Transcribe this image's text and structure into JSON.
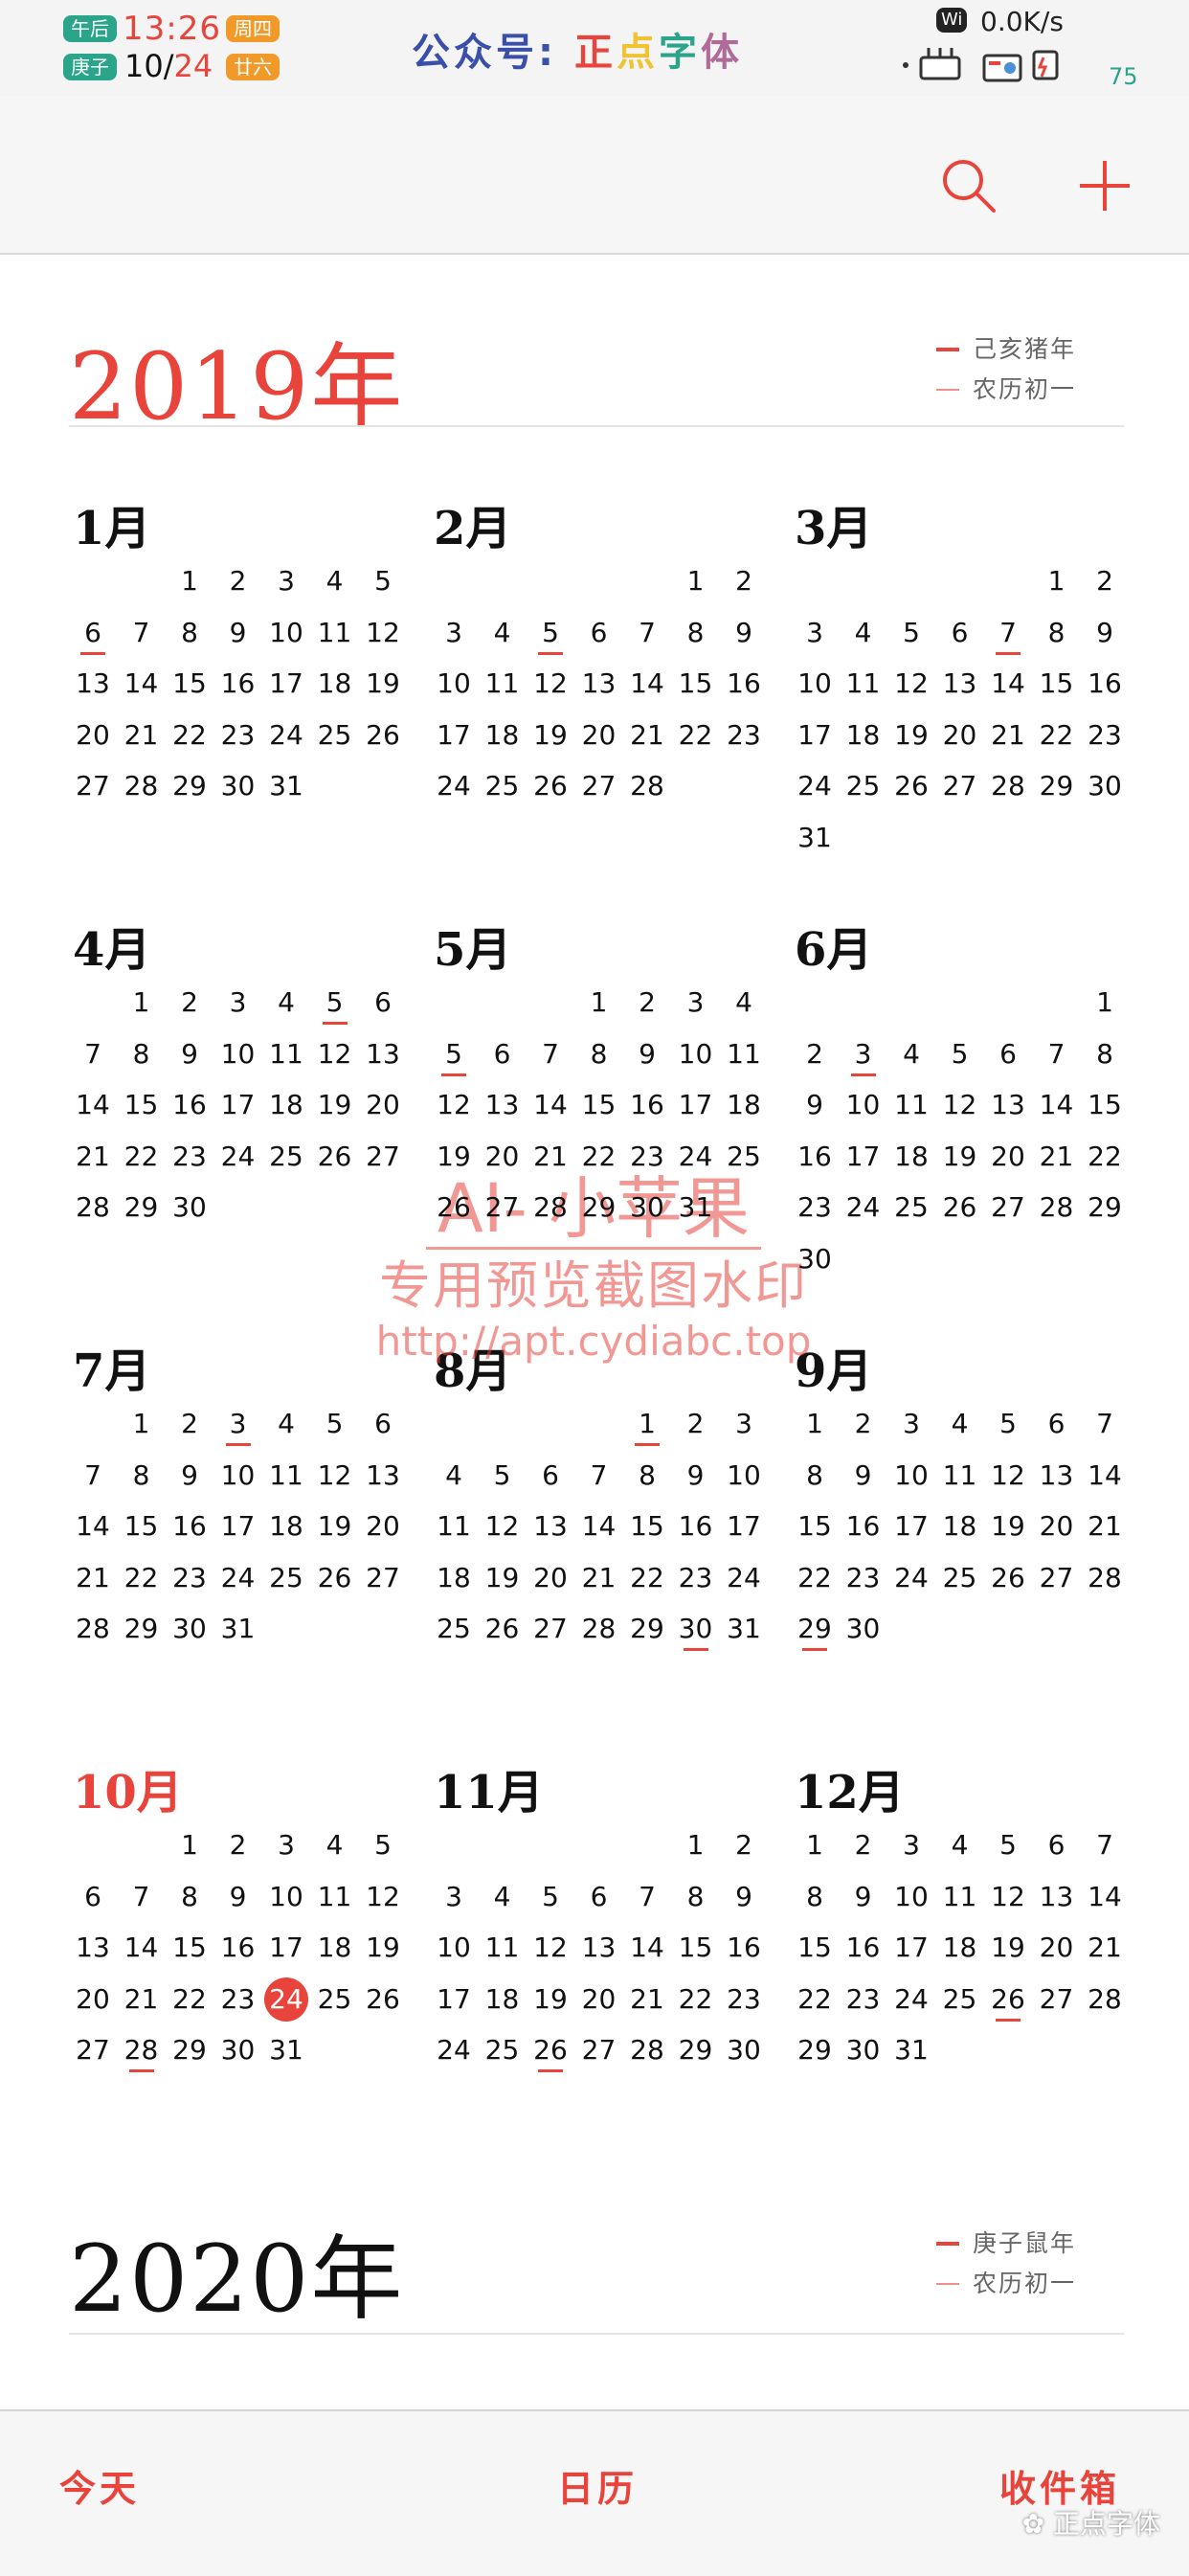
{
  "status_bar": {
    "ampm_badge": "午后",
    "time": "13:26",
    "weekday_badge": "周四",
    "month_badge": "庚子",
    "date_month": "10",
    "date_day": "24",
    "lunar_badge": "廿六",
    "title": "公众号: 正点字体",
    "wifi_label": "Wi",
    "net_speed": "0.0K/s",
    "battery": "75",
    "colors": {
      "green": "#2aa58a",
      "orange": "#f19a2a",
      "red": "#e8443c"
    }
  },
  "nav": {
    "search_icon": "search-icon",
    "add_icon": "plus-icon"
  },
  "years": [
    {
      "title": "2019年",
      "legend": [
        "己亥猪年",
        "农历初一"
      ],
      "months": [
        {
          "name": "1月",
          "offset": 2,
          "days": 31,
          "underlined": [
            6
          ],
          "today": null
        },
        {
          "name": "2月",
          "offset": 5,
          "days": 28,
          "underlined": [
            5
          ],
          "today": null
        },
        {
          "name": "3月",
          "offset": 5,
          "days": 31,
          "underlined": [
            7
          ],
          "today": null
        },
        {
          "name": "4月",
          "offset": 1,
          "days": 30,
          "underlined": [
            5
          ],
          "today": null
        },
        {
          "name": "5月",
          "offset": 3,
          "days": 31,
          "underlined": [
            5
          ],
          "today": null
        },
        {
          "name": "6月",
          "offset": 6,
          "days": 30,
          "underlined": [
            3
          ],
          "today": null
        },
        {
          "name": "7月",
          "offset": 1,
          "days": 31,
          "underlined": [
            3
          ],
          "today": null
        },
        {
          "name": "8月",
          "offset": 4,
          "days": 31,
          "underlined": [
            1,
            30
          ],
          "today": null
        },
        {
          "name": "9月",
          "offset": 0,
          "days": 30,
          "underlined": [
            29
          ],
          "today": null
        },
        {
          "name": "10月",
          "offset": 2,
          "days": 31,
          "underlined": [
            28
          ],
          "today": 24,
          "current": true
        },
        {
          "name": "11月",
          "offset": 5,
          "days": 30,
          "underlined": [
            26
          ],
          "today": null
        },
        {
          "name": "12月",
          "offset": 0,
          "days": 31,
          "underlined": [
            26
          ],
          "today": null
        }
      ]
    },
    {
      "title": "2020年",
      "legend": [
        "庚子鼠年",
        "农历初一"
      ]
    }
  ],
  "watermark": {
    "line1": "AI- 小苹果",
    "line2": "专用预览截图水印",
    "line3": "http://apt.cydiabc.top"
  },
  "tabbar": {
    "today": "今天",
    "calendar": "日历",
    "inbox": "收件箱",
    "wechat_brand": "正点字体"
  }
}
